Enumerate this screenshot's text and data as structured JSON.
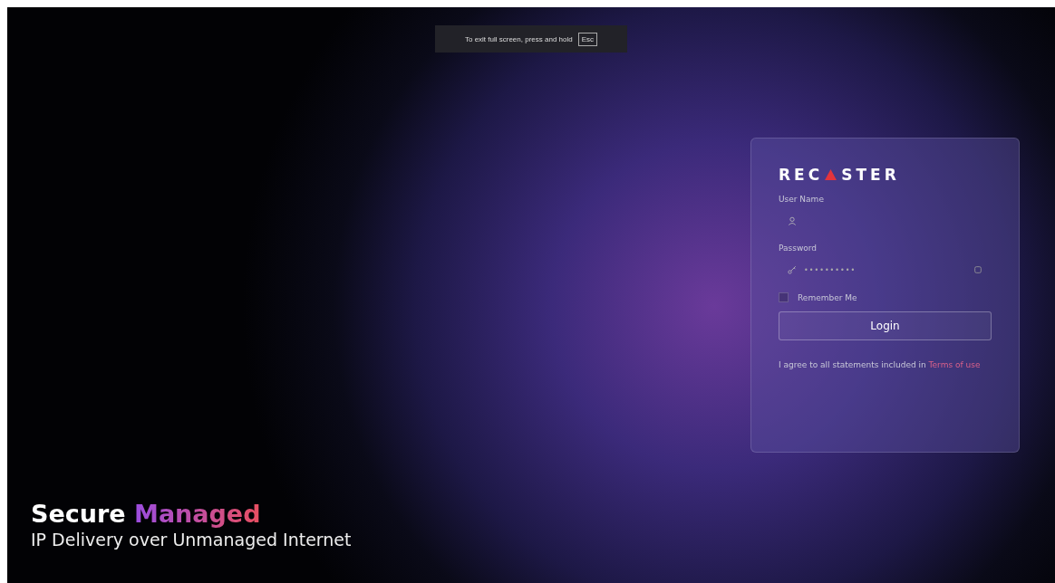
{
  "fullscreen_notice": {
    "text": "To exit full screen, press and hold",
    "key": "Esc"
  },
  "login": {
    "logo": {
      "before": "REC",
      "after": "STER"
    },
    "username": {
      "label": "User Name"
    },
    "password": {
      "label": "Password",
      "value": "••••••••••"
    },
    "remember": {
      "label": "Remember Me",
      "checked": false
    },
    "button": "Login",
    "agreement": {
      "text": "I agree to all statements included in",
      "link": "Terms of use"
    }
  },
  "hero": {
    "title_plain": "Secure",
    "title_accent": "Managed",
    "subtitle": "IP Delivery over Unmanaged Internet"
  }
}
